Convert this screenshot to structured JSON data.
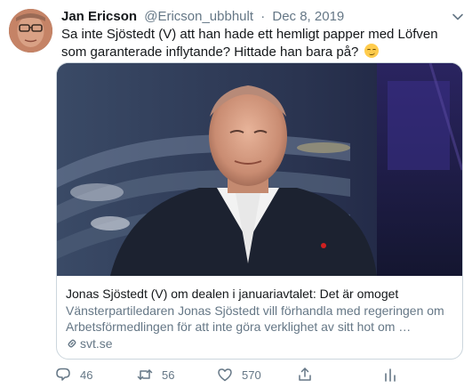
{
  "tweet": {
    "author_name": "Jan Ericson",
    "handle": "@Ericson_ubbhult",
    "separator": "·",
    "date": "Dec 8, 2019",
    "text": "Sa inte Sjöstedt (V) att han hade ett hemligt papper med Löfven som garanterade inflytande? Hittade han bara på?",
    "emoji": "smirking-face"
  },
  "card": {
    "title": "Jonas Sjöstedt (V) om dealen i januariavtalet: Det är omoget",
    "description": "Vänsterpartiledaren Jonas Sjöstedt vill förhandla med regeringen om Arbetsförmedlingen för att inte göra verklighet av sitt hot om …",
    "domain": "svt.se"
  },
  "actions": {
    "replies": "46",
    "retweets": "56",
    "likes": "570"
  },
  "colors": {
    "text": "#14171a",
    "secondary": "#657786",
    "border": "#ccd6dd"
  }
}
